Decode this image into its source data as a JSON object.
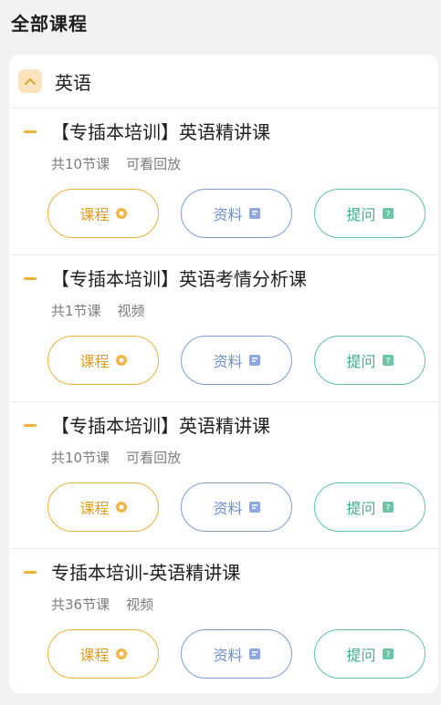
{
  "page": {
    "title": "全部课程"
  },
  "section": {
    "label": "英语",
    "toggle_icon": "chevron-up-icon"
  },
  "courses": [
    {
      "title": "【专插本培训】英语精讲课",
      "lessons": "共10节课",
      "note": "可看回放"
    },
    {
      "title": "【专插本培训】英语考情分析课",
      "lessons": "共1节课",
      "note": "视频"
    },
    {
      "title": "【专插本培训】英语精讲课",
      "lessons": "共10节课",
      "note": "可看回放"
    },
    {
      "title": "专插本培训-英语精讲课",
      "lessons": "共36节课",
      "note": "视频"
    }
  ],
  "buttons": {
    "course": "课程",
    "material": "资料",
    "ask": "提问"
  },
  "colors": {
    "accent_yellow": "#efb13a",
    "material_blue": "#7f9ed6",
    "ask_green": "#5fc2a0"
  }
}
